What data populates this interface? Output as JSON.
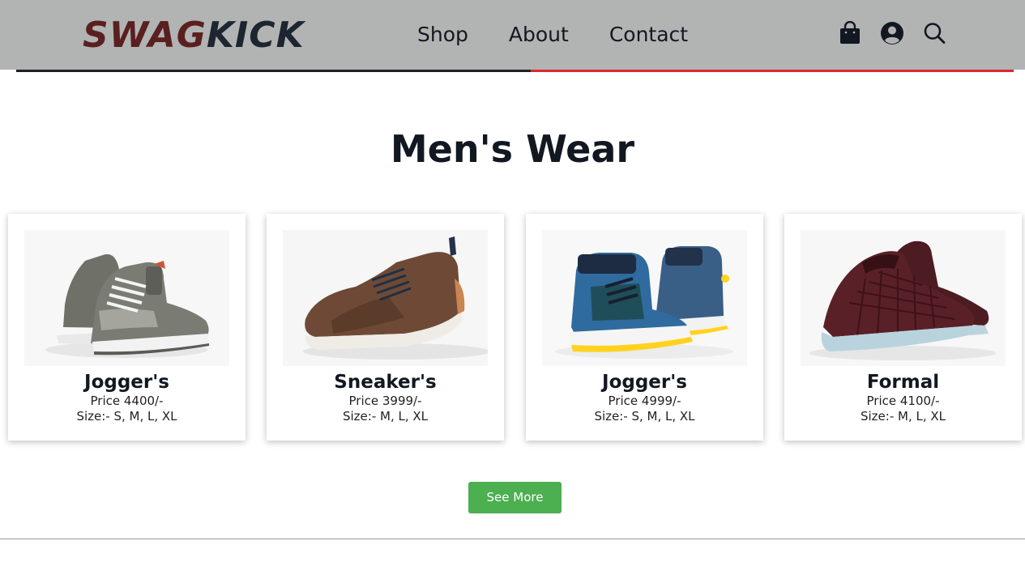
{
  "brand": {
    "part1": "SWAG",
    "part2": "KICK",
    "color1": "#5a1f1f",
    "color2": "#1d2530"
  },
  "nav": {
    "items": [
      {
        "label": "Shop"
      },
      {
        "label": "About"
      },
      {
        "label": "Contact"
      }
    ]
  },
  "header_icons": [
    "shopping-bag-icon",
    "user-circle-icon",
    "search-icon"
  ],
  "header_bg": "#b2b3b3",
  "accent_colors": {
    "bar_dark": "#1d2129",
    "bar_red": "#d72b2b",
    "button": "#4caf50"
  },
  "section": {
    "title": "Men's Wear"
  },
  "products": [
    {
      "name": "Jogger's",
      "price": "Price 4400/-",
      "size": "Size:- S, M, L, XL",
      "image": "grey-high-top-sneaker"
    },
    {
      "name": "Sneaker's",
      "price": "Price 3999/-",
      "size": "Size:- M, L, XL",
      "image": "brown-leather-sneaker"
    },
    {
      "name": "Jogger's",
      "price": "Price 4999/-",
      "size": "Size:- S, M, L, XL",
      "image": "blue-high-top-sneaker"
    },
    {
      "name": "Formal",
      "price": "Price 4100/-",
      "size": "Size:- M, L, XL",
      "image": "maroon-woven-slip-on"
    }
  ],
  "see_more_label": "See More"
}
